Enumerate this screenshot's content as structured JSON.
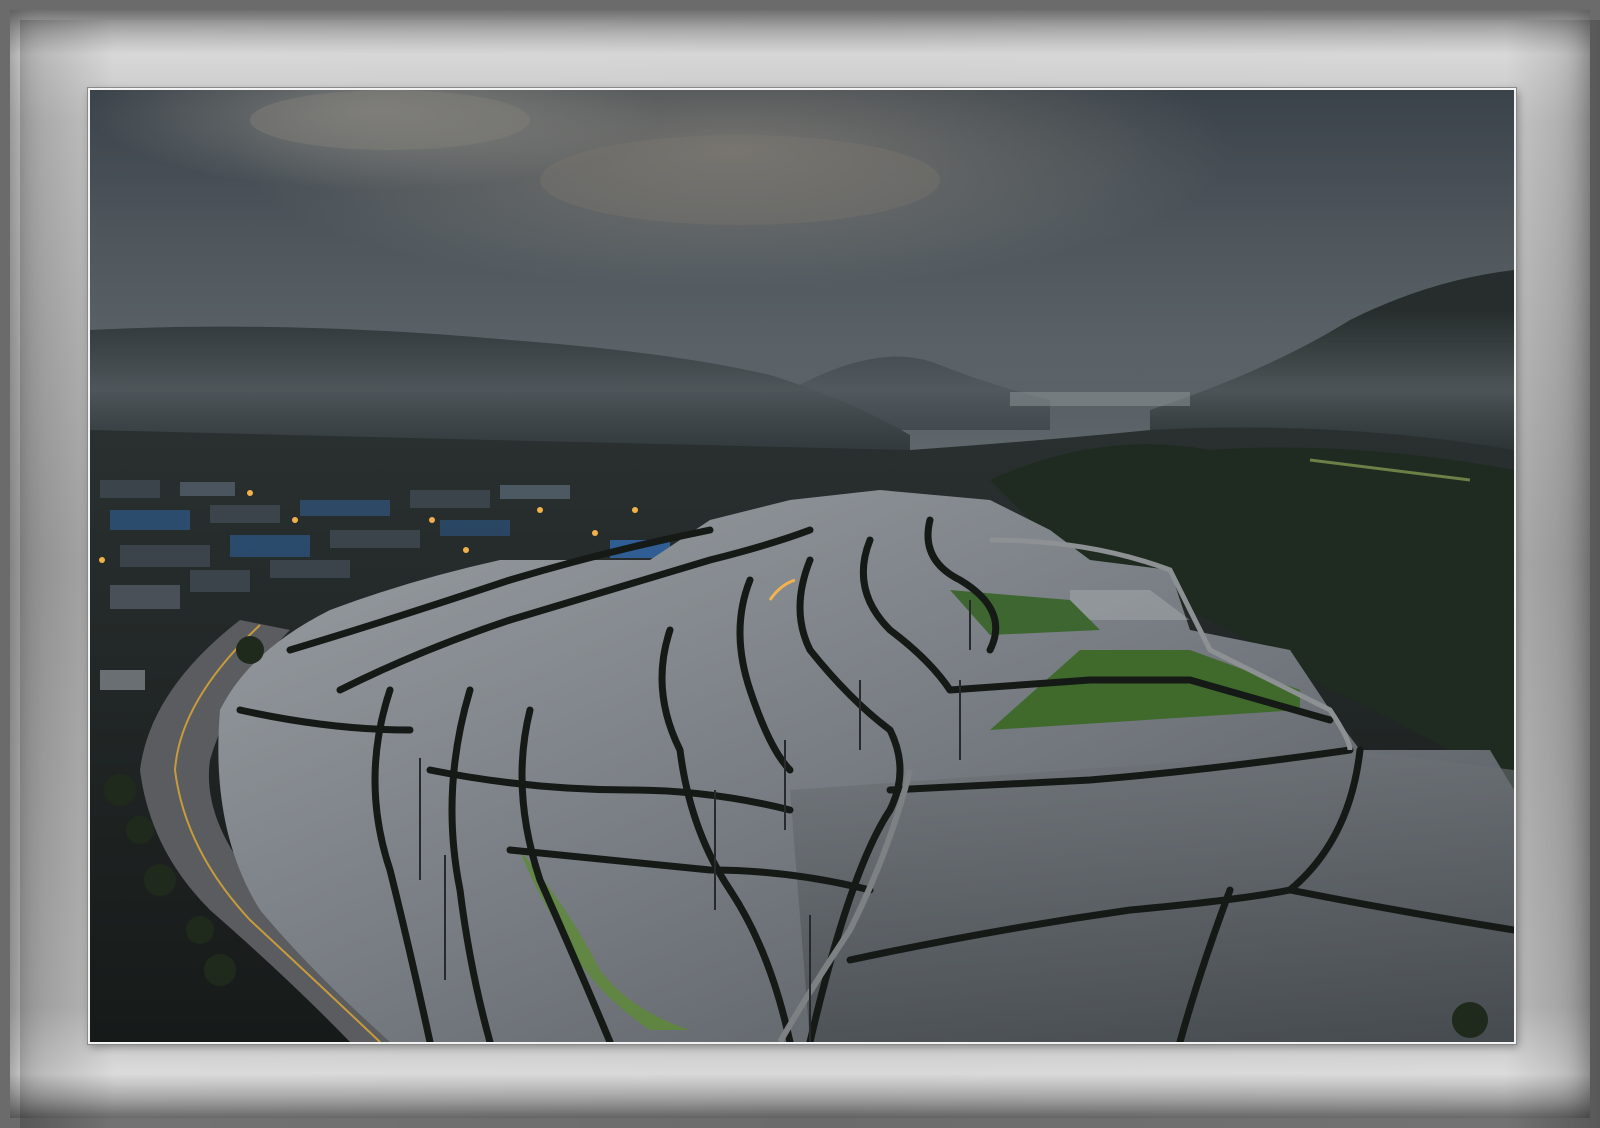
{
  "image": {
    "subject": "flooded-rice-terraces-valley-at-dusk",
    "colors": {
      "sky_top": "#3c444b",
      "sky_glow": "#8a8276",
      "fog": "#5f666b",
      "mountain": "#23292b",
      "water": "#8b9096",
      "water_dark": "#4d5257",
      "levee": "#1a1f1c",
      "grass": "#3f6a2c",
      "road": "#5b5d60",
      "streetlight": "#f2b14a",
      "frame_light": "#d6d6d6",
      "frame_dark": "#6b6b6b"
    }
  }
}
